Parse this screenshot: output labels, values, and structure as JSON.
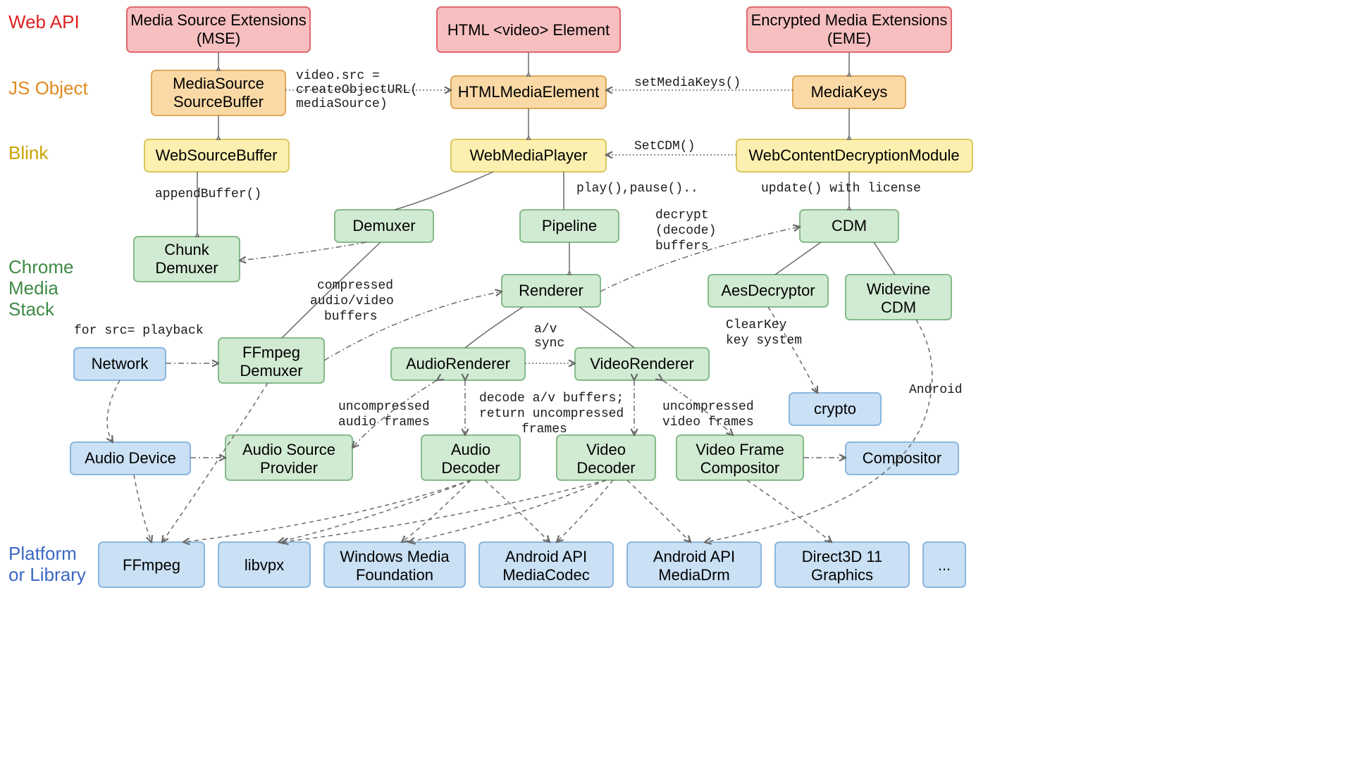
{
  "rows": {
    "webapi": "Web API",
    "jsobject": "JS Object",
    "blink": "Blink",
    "chrome1": "Chrome",
    "chrome2": "Media",
    "chrome3": "Stack",
    "platform1": "Platform",
    "platform2": "or Library"
  },
  "nodes": {
    "mse1": "Media Source Extensions",
    "mse2": "(MSE)",
    "video": "HTML <video> Element",
    "eme1": "Encrypted Media Extensions",
    "eme2": "(EME)",
    "mssb1": "MediaSource",
    "mssb2": "SourceBuffer",
    "hme": "HTMLMediaElement",
    "mk": "MediaKeys",
    "wsb": "WebSourceBuffer",
    "wmp": "WebMediaPlayer",
    "wcdm": "WebContentDecryptionModule",
    "chunk1": "Chunk",
    "chunk2": "Demuxer",
    "demux": "Demuxer",
    "pipe": "Pipeline",
    "cdm": "CDM",
    "rend": "Renderer",
    "aes": "AesDecryptor",
    "wv1": "Widevine",
    "wv2": "CDM",
    "net": "Network",
    "ffd1": "FFmpeg",
    "ffd2": "Demuxer",
    "arend": "AudioRenderer",
    "vrend": "VideoRenderer",
    "crypto": "crypto",
    "adev": "Audio Device",
    "asp1": "Audio Source",
    "asp2": "Provider",
    "adec1": "Audio",
    "adec2": "Decoder",
    "vdec1": "Video",
    "vdec2": "Decoder",
    "vfc1": "Video Frame",
    "vfc2": "Compositor",
    "comp": "Compositor",
    "pl_ff": "FFmpeg",
    "pl_vpx": "libvpx",
    "pl_wmf1": "Windows Media",
    "pl_wmf2": "Foundation",
    "pl_amc1": "Android API",
    "pl_amc2": "MediaCodec",
    "pl_amd1": "Android API",
    "pl_amd2": "MediaDrm",
    "pl_d3d1": "Direct3D 11",
    "pl_d3d2": "Graphics",
    "pl_more": "..."
  },
  "notes": {
    "src1": "video.src =",
    "src2": "createObjectURL(",
    "src3": "mediaSource)",
    "smk": "setMediaKeys()",
    "scdm": "SetCDM()",
    "append": "appendBuffer()",
    "play": "play(),pause()..",
    "upd": "update() with license",
    "comp1": "compressed",
    "comp2": "audio/video",
    "comp3": "buffers",
    "srcpb": "for src= playback",
    "avsync1": "a/v",
    "avsync2": "sync",
    "uaf1": "uncompressed",
    "uaf2": "audio frames",
    "dav1": "decode a/v buffers;",
    "dav2": "return uncompressed",
    "dav3": "frames",
    "uvf1": "uncompressed",
    "uvf2": "video frames",
    "dd1": "decrypt",
    "dd2": "(decode)",
    "dd3": "buffers",
    "ck1": "ClearKey",
    "ck2": "key system",
    "android": "Android"
  }
}
